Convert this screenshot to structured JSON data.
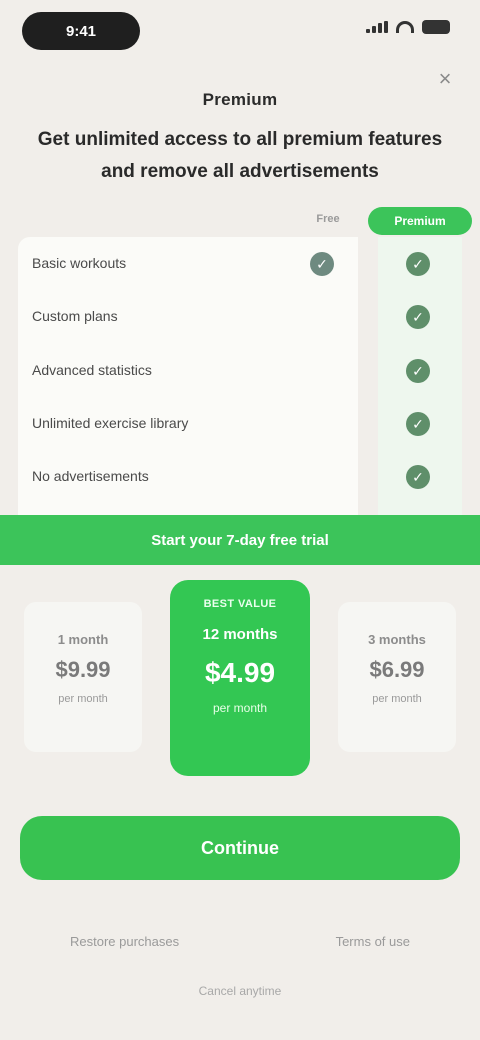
{
  "status_bar": {
    "time": "9:41",
    "icons": [
      "signal-icon",
      "wifi-icon",
      "battery-icon"
    ]
  },
  "close": {
    "icon": "close-icon",
    "glyph": "×"
  },
  "page_title": "Premium",
  "headline": "Get unlimited access to all premium features and remove all advertisements",
  "compare": {
    "free_label": "Free",
    "premium_label": "Premium",
    "rows": [
      {
        "label": "Basic workouts",
        "free": true,
        "premium": true
      },
      {
        "label": "Custom plans",
        "free": false,
        "premium": true
      },
      {
        "label": "Advanced statistics",
        "free": false,
        "premium": true
      },
      {
        "label": "Unlimited exercise library",
        "free": false,
        "premium": true
      },
      {
        "label": "No advertisements",
        "free": false,
        "premium": true
      }
    ]
  },
  "trial_banner": "Start your 7-day free trial",
  "plans": {
    "left": {
      "period": "1 month",
      "price": "$9.99",
      "note": "per month"
    },
    "selected": {
      "badge": "BEST VALUE",
      "period": "12 months",
      "price": "$4.99",
      "note": "per month"
    },
    "right": {
      "period": "3 months",
      "price": "$6.99",
      "note": "per month"
    }
  },
  "cta": {
    "label": "Continue"
  },
  "footer": {
    "restore": "Restore purchases",
    "terms": "Terms of use",
    "note": "Cancel anytime"
  },
  "colors": {
    "accent": "#3cc45a",
    "background": "#f1eeea"
  }
}
